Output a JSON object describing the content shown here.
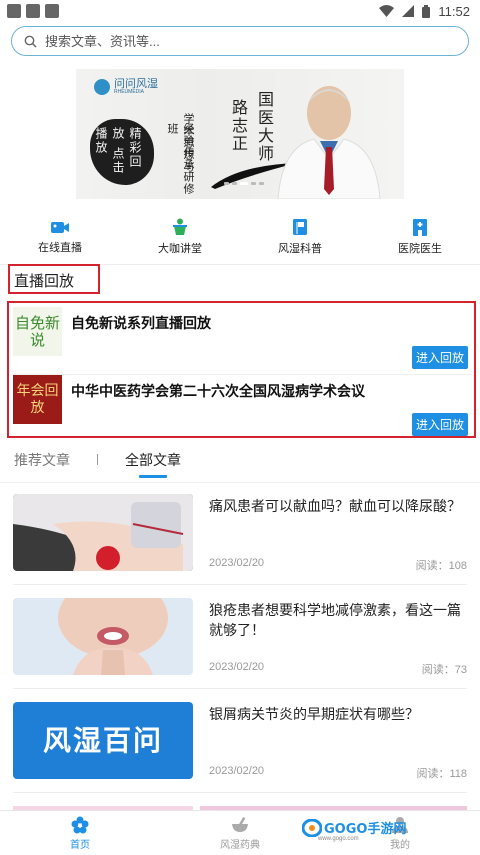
{
  "status_bar": {
    "time": "11:52"
  },
  "search": {
    "placeholder": "搜索文章、资讯等..."
  },
  "banner": {
    "logo_text": "问问风湿",
    "logo_sub": "RHEUMEDIA",
    "ink_text": "精彩回放 点击播放",
    "col1": "学术思想与",
    "col2": "经验传承研修班",
    "col3": "路志正",
    "col4": "国医大师"
  },
  "quick_nav": [
    {
      "label": "在线直播",
      "icon": "video-camera-icon"
    },
    {
      "label": "大咖讲堂",
      "icon": "lecture-podium-icon"
    },
    {
      "label": "风湿科普",
      "icon": "book-icon"
    },
    {
      "label": "医院医生",
      "icon": "hospital-building-icon"
    }
  ],
  "live_section": {
    "title": "直播回放",
    "items": [
      {
        "thumb_text": "自免新说",
        "title": "自免新说系列直播回放",
        "button": "进入回放"
      },
      {
        "thumb_text": "年会回放",
        "title": "中华中医药学会第二十六次全国风湿病学术会议",
        "button": "进入回放"
      }
    ]
  },
  "article_tabs": {
    "recommend": "推荐文章",
    "all": "全部文章"
  },
  "articles": [
    {
      "title": "痛风患者可以献血吗？献血可以降尿酸？",
      "date": "2023/02/20",
      "reads": "阅读：108"
    },
    {
      "title": "狼疮患者想要科学地减停激素，看这一篇就够了！",
      "date": "2023/02/20",
      "reads": "阅读：73"
    },
    {
      "title": "银屑病关节炎的早期症状有哪些？",
      "date": "2023/02/20",
      "reads": "阅读：118",
      "image_text": "风湿百问"
    }
  ],
  "bottom_nav": [
    {
      "label": "首页",
      "active": true
    },
    {
      "label": "风湿药典",
      "active": false
    },
    {
      "label": "我的",
      "active": false
    }
  ],
  "watermark": {
    "text": "GOGO手游网",
    "sub": "www.gogo.com"
  },
  "colors": {
    "accent": "#1e8fe2",
    "highlight_border": "#d3232e"
  }
}
